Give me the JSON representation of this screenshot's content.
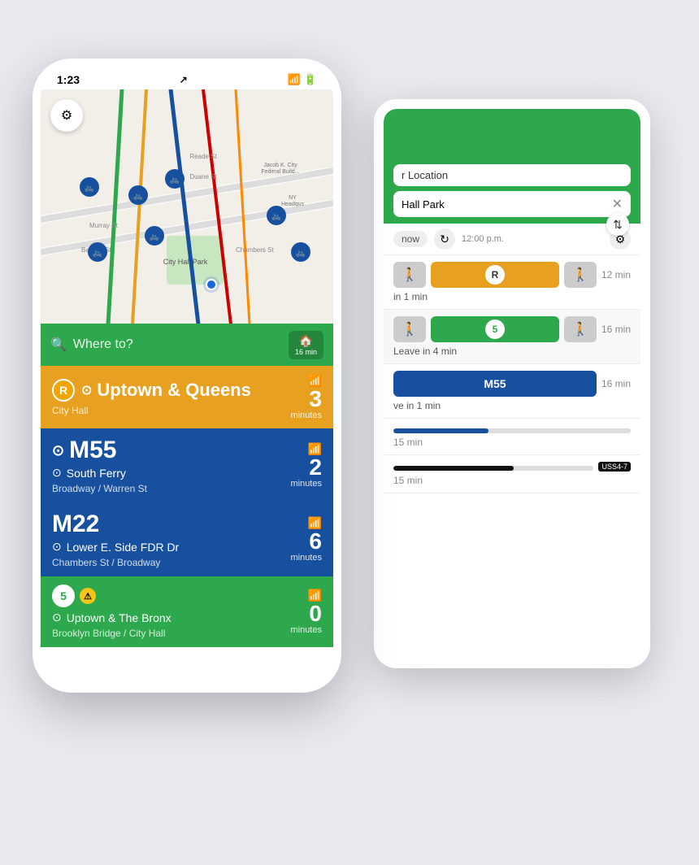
{
  "scene": {
    "bg_color": "#e8eaf0"
  },
  "front_phone": {
    "status_bar": {
      "time": "1:23",
      "location_arrow": "↗",
      "wifi": "WiFi",
      "battery": "Battery"
    },
    "search": {
      "placeholder": "Where to?",
      "home_label": "16 min"
    },
    "routes": [
      {
        "id": "r",
        "bg": "r",
        "route_name": "R",
        "direction_arrow": "⊙",
        "direction": "Uptown & Queens",
        "stop": "City Hall",
        "minutes": "3",
        "minutes_label": "minutes",
        "has_wifi": true
      },
      {
        "id": "m55",
        "bg": "m55",
        "route_name": "M55",
        "direction_arrow": "⊙",
        "direction": "South Ferry",
        "stop": "Broadway / Warren St",
        "minutes": "2",
        "minutes_label": "minutes",
        "has_wifi": true
      },
      {
        "id": "m22",
        "bg": "m22",
        "route_name": "M22",
        "direction_arrow": "⊙",
        "direction": "Lower E. Side FDR Dr",
        "stop": "Chambers St / Broadway",
        "minutes": "6",
        "minutes_label": "minutes",
        "has_wifi": true
      },
      {
        "id": "5",
        "bg": "5",
        "route_name": "5",
        "direction_arrow": "⊙",
        "direction": "Uptown & The Bronx",
        "stop": "Brooklyn Bridge / City Hall",
        "minutes": "0",
        "minutes_label": "minutes",
        "has_wifi": true,
        "has_alert": true
      }
    ]
  },
  "back_phone": {
    "from_label": "r Location",
    "to_label": "Hall Park",
    "depart_label": "now",
    "time_label": "12:00 p.m.",
    "results": [
      {
        "segments": [
          "walk",
          "R",
          "walk"
        ],
        "colors": [
          "gray",
          "yellow",
          "gray"
        ],
        "leave_label": "in 1 min",
        "duration": "12 min"
      },
      {
        "segments": [
          "walk",
          "5",
          "walk"
        ],
        "colors": [
          "gray",
          "green",
          "gray"
        ],
        "leave_label": "Leave in 4 min",
        "duration": "16 min"
      },
      {
        "segments": [
          "M55"
        ],
        "colors": [
          "blue"
        ],
        "leave_label": "ve in 1 min",
        "duration": "16 min"
      },
      {
        "segments": [
          "bar"
        ],
        "leave_label": "",
        "duration": "15 min"
      },
      {
        "segments": [
          "bar_dark",
          "USS4-7"
        ],
        "leave_label": "",
        "duration": "15 min"
      }
    ]
  }
}
